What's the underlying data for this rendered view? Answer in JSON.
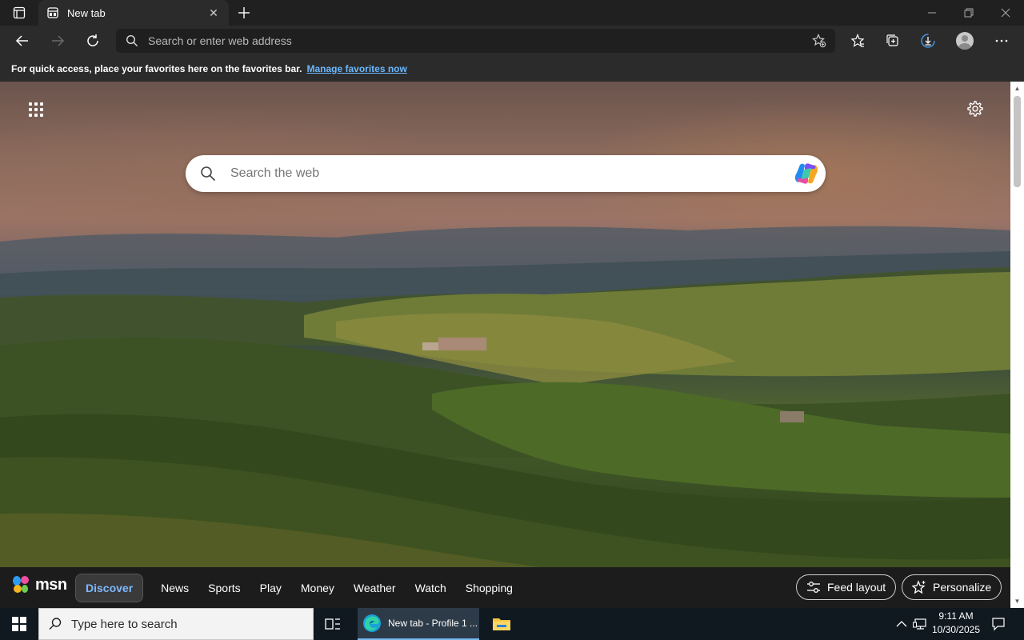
{
  "browser": {
    "tab": {
      "title": "New tab",
      "close_glyph": "✕"
    },
    "address_bar": {
      "placeholder": "Search or enter web address"
    },
    "favorites_bar": {
      "message": "For quick access, place your favorites here on the favorites bar.",
      "link": "Manage favorites now",
      "link_color": "#6cb8ff"
    }
  },
  "new_tab_page": {
    "search": {
      "placeholder": "Search the web"
    },
    "msn": {
      "logo_text": "msn",
      "nav_items": [
        "Discover",
        "News",
        "Sports",
        "Play",
        "Money",
        "Weather",
        "Watch",
        "Shopping"
      ],
      "active_nav": "Discover",
      "feed_layout_label": "Feed layout",
      "personalize_label": "Personalize"
    }
  },
  "taskbar": {
    "search_placeholder": "Type here to search",
    "edge_item_label": "New tab - Profile 1 ...",
    "clock": {
      "time": "9:11 AM",
      "date": "10/30/2025"
    }
  },
  "colors": {
    "accent_link": "#6cb8ff",
    "msn_active": "#7eb9ff",
    "taskbar_bg": "#101820"
  }
}
